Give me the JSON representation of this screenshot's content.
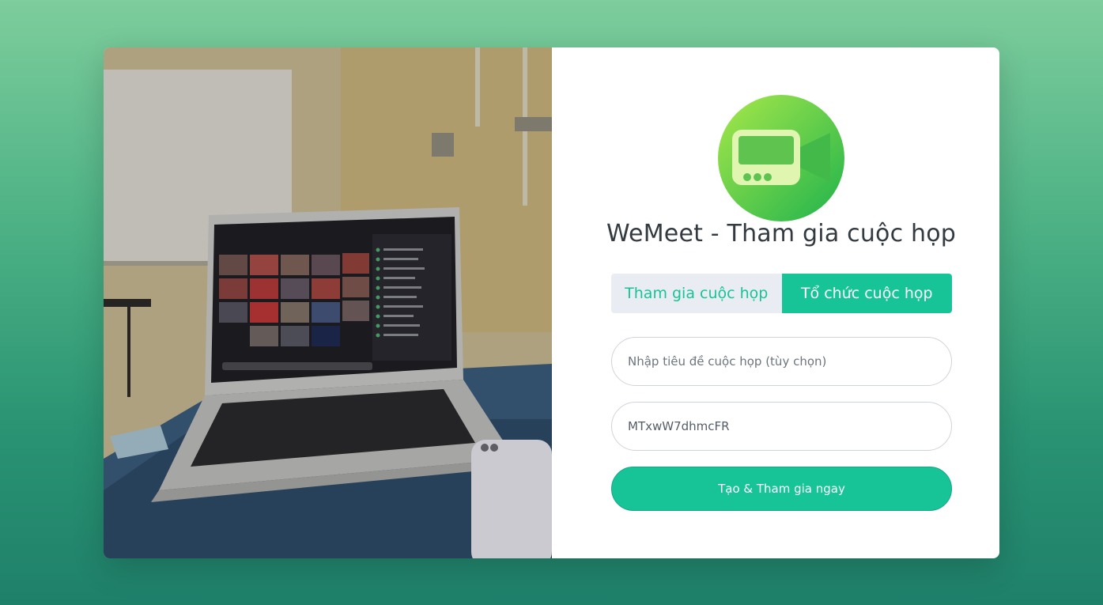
{
  "app": {
    "title": "WeMeet - Tham gia cuộc họp"
  },
  "tabs": [
    {
      "label": "Tham gia cuộc họp",
      "active": false
    },
    {
      "label": "Tổ chức cuộc họp",
      "active": true
    }
  ],
  "form": {
    "title_input": {
      "placeholder": "Nhập tiêu đề cuộc họp (tùy chọn)",
      "value": ""
    },
    "code_input": {
      "placeholder": "",
      "value": "MTxwW7dhmcFR"
    },
    "submit_label": "Tạo & Tham gia ngay"
  },
  "icons": {
    "logo": "video-camera-icon",
    "hero": "laptop-video-call-photo"
  },
  "colors": {
    "accent": "#17c497",
    "tab_inactive_bg": "#e9ecf2",
    "title_text": "#333a40"
  }
}
